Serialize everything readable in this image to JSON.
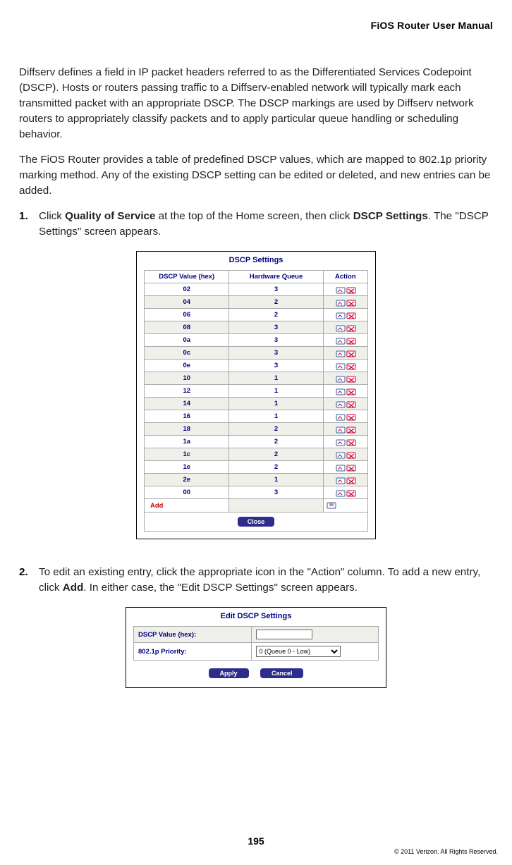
{
  "header": {
    "title": "FiOS Router User Manual"
  },
  "paras": {
    "p1": "Diffserv defines a field in IP packet headers referred to as the Differentiated Services Codepoint (DSCP). Hosts or routers passing traffic to a Diffserv-enabled network will typically mark each transmitted packet with an appropriate DSCP. The DSCP markings are used by Diffserv network routers to appropriately classify packets and to apply particular queue handling or scheduling behavior.",
    "p2": "The FiOS Router provides a table of predefined DSCP values, which are mapped to 802.1p priority marking method. Any of the existing DSCP setting can be edited or deleted, and new entries can be added."
  },
  "steps": {
    "s1_num": "1.",
    "s1_pre": "Click ",
    "s1_b1": "Quality of Service",
    "s1_mid": " at the top of the Home screen, then click ",
    "s1_b2": "DSCP Settings",
    "s1_post": ". The \"DSCP Settings\" screen appears.",
    "s2_num": "2.",
    "s2_pre": " To edit an existing entry, click the appropriate icon in the \"Action\" column. To add a new entry, click ",
    "s2_b": "Add",
    "s2_post": ". In either case, the \"Edit DSCP Settings\" screen appears."
  },
  "fig1": {
    "title": "DSCP Settings",
    "headers": [
      "DSCP Value (hex)",
      "Hardware Queue",
      "Action"
    ],
    "rows": [
      {
        "val": "02",
        "queue": "3"
      },
      {
        "val": "04",
        "queue": "2"
      },
      {
        "val": "06",
        "queue": "2"
      },
      {
        "val": "08",
        "queue": "3"
      },
      {
        "val": "0a",
        "queue": "3"
      },
      {
        "val": "0c",
        "queue": "3"
      },
      {
        "val": "0e",
        "queue": "3"
      },
      {
        "val": "10",
        "queue": "1"
      },
      {
        "val": "12",
        "queue": "1"
      },
      {
        "val": "14",
        "queue": "1"
      },
      {
        "val": "16",
        "queue": "1"
      },
      {
        "val": "18",
        "queue": "2"
      },
      {
        "val": "1a",
        "queue": "2"
      },
      {
        "val": "1c",
        "queue": "2"
      },
      {
        "val": "1e",
        "queue": "2"
      },
      {
        "val": "2e",
        "queue": "1"
      },
      {
        "val": "00",
        "queue": "3"
      }
    ],
    "add_label": "Add",
    "close_label": "Close"
  },
  "fig2": {
    "title": "Edit DSCP Settings",
    "row1_label": "DSCP Value (hex):",
    "row1_value": "",
    "row2_label": "802.1p Priority:",
    "row2_selected": "0 (Queue 0 - Low)",
    "apply_label": "Apply",
    "cancel_label": "Cancel"
  },
  "footer": {
    "page": "195",
    "copyright": "© 2011 Verizon. All Rights Reserved."
  }
}
